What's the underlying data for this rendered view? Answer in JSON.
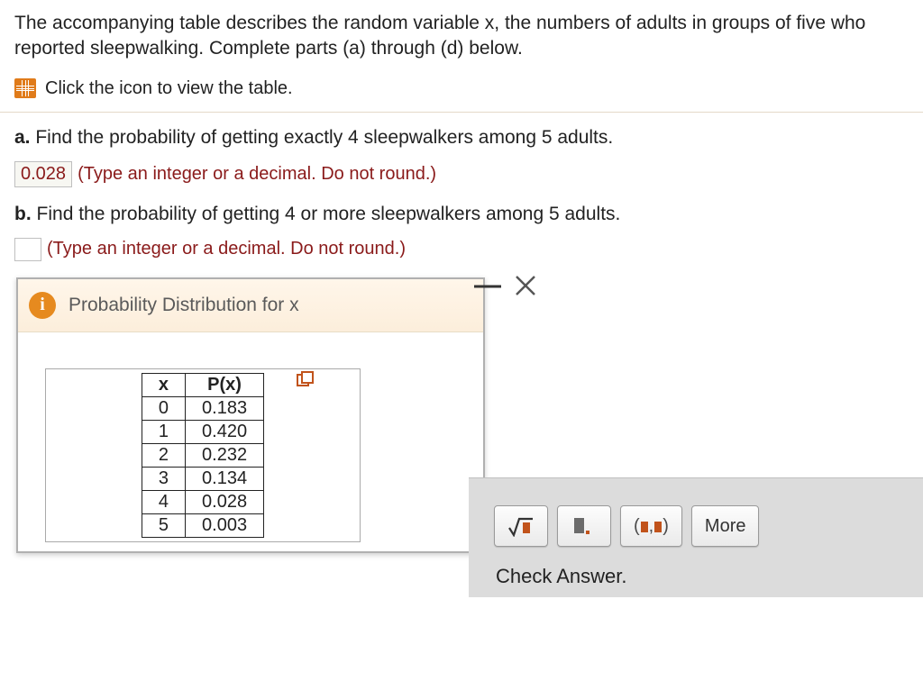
{
  "problem": {
    "intro": "The accompanying table describes the random variable x, the numbers of adults in groups of five who reported sleepwalking. Complete parts (a) through (d) below.",
    "view_table_label": "Click the icon to view the table."
  },
  "parts": {
    "a": {
      "label": "a.",
      "text": "Find the probability of getting exactly 4 sleepwalkers among 5 adults.",
      "answer": "0.028",
      "hint": "(Type an integer or a decimal. Do not round.)"
    },
    "b": {
      "label": "b.",
      "text": "Find the probability of getting 4 or more sleepwalkers among 5 adults.",
      "hint": "(Type an integer or a decimal. Do not round.)"
    }
  },
  "popup": {
    "title": "Probability Distribution for x",
    "columns": {
      "x": "x",
      "px": "P(x)"
    },
    "rows": [
      {
        "x": "0",
        "px": "0.183"
      },
      {
        "x": "1",
        "px": "0.420"
      },
      {
        "x": "2",
        "px": "0.232"
      },
      {
        "x": "3",
        "px": "0.134"
      },
      {
        "x": "4",
        "px": "0.028"
      },
      {
        "x": "5",
        "px": "0.003"
      }
    ]
  },
  "toolbar": {
    "more_label": "More",
    "check_label": "Check Answer."
  },
  "chart_data": {
    "type": "table",
    "title": "Probability Distribution for x",
    "columns": [
      "x",
      "P(x)"
    ],
    "rows": [
      [
        0,
        0.183
      ],
      [
        1,
        0.42
      ],
      [
        2,
        0.232
      ],
      [
        3,
        0.134
      ],
      [
        4,
        0.028
      ],
      [
        5,
        0.003
      ]
    ]
  }
}
